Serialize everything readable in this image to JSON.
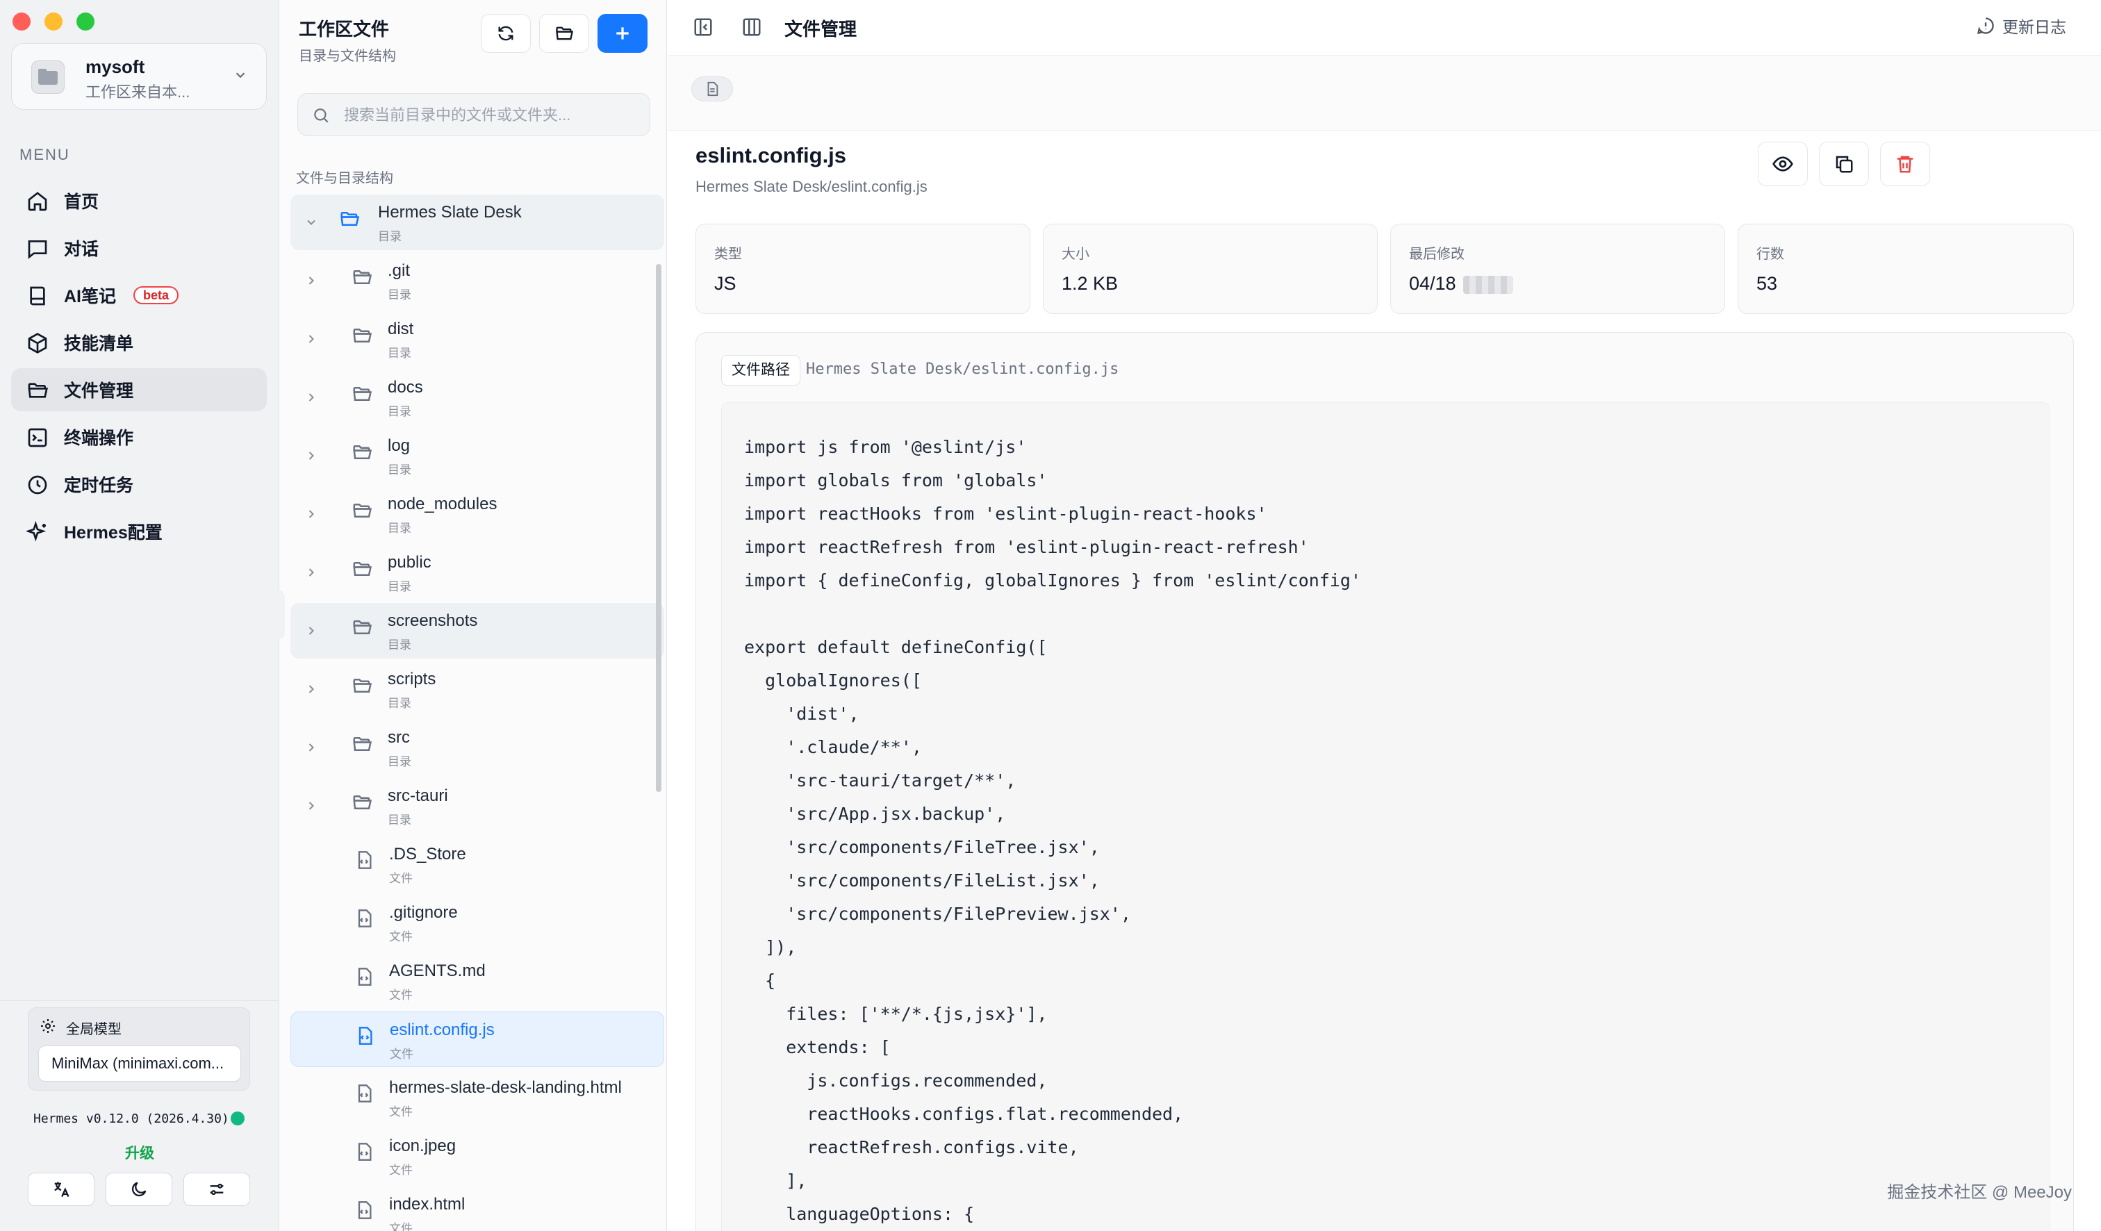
{
  "sidebar": {
    "workspace": {
      "name": "mysoft",
      "subtitle": "工作区来自本..."
    },
    "menu_label": "MENU",
    "items": [
      {
        "label": "首页",
        "icon": "home-icon"
      },
      {
        "label": "对话",
        "icon": "chat-icon"
      },
      {
        "label": "AI笔记",
        "icon": "notebook-icon",
        "badge": "beta"
      },
      {
        "label": "技能清单",
        "icon": "package-icon"
      },
      {
        "label": "文件管理",
        "icon": "folder-icon",
        "active": true
      },
      {
        "label": "终端操作",
        "icon": "terminal-icon"
      },
      {
        "label": "定时任务",
        "icon": "clock-icon"
      },
      {
        "label": "Hermes配置",
        "icon": "sparkles-icon"
      }
    ],
    "model": {
      "title": "全局模型",
      "value": "MiniMax (minimaxi.com..."
    },
    "version": "Hermes v0.12.0 (2026.4.30)",
    "upgrade": "升级"
  },
  "filepane": {
    "title": "工作区文件",
    "subtitle": "目录与文件结构",
    "search_placeholder": "搜索当前目录中的文件或文件夹...",
    "tree_label": "文件与目录结构",
    "root": {
      "name": "Hermes Slate Desk",
      "type": "目录"
    },
    "entries": [
      {
        "name": ".git",
        "type": "目录",
        "kind": "dir"
      },
      {
        "name": "dist",
        "type": "目录",
        "kind": "dir"
      },
      {
        "name": "docs",
        "type": "目录",
        "kind": "dir"
      },
      {
        "name": "log",
        "type": "目录",
        "kind": "dir"
      },
      {
        "name": "node_modules",
        "type": "目录",
        "kind": "dir"
      },
      {
        "name": "public",
        "type": "目录",
        "kind": "dir"
      },
      {
        "name": "screenshots",
        "type": "目录",
        "kind": "dir",
        "hover": true
      },
      {
        "name": "scripts",
        "type": "目录",
        "kind": "dir"
      },
      {
        "name": "src",
        "type": "目录",
        "kind": "dir"
      },
      {
        "name": "src-tauri",
        "type": "目录",
        "kind": "dir"
      },
      {
        "name": ".DS_Store",
        "type": "文件",
        "kind": "file"
      },
      {
        "name": ".gitignore",
        "type": "文件",
        "kind": "file"
      },
      {
        "name": "AGENTS.md",
        "type": "文件",
        "kind": "file"
      },
      {
        "name": "eslint.config.js",
        "type": "文件",
        "kind": "file",
        "selected": true
      },
      {
        "name": "hermes-slate-desk-landing.html",
        "type": "文件",
        "kind": "file"
      },
      {
        "name": "icon.jpeg",
        "type": "文件",
        "kind": "file"
      },
      {
        "name": "index.html",
        "type": "文件",
        "kind": "file"
      }
    ]
  },
  "main": {
    "page_title": "文件管理",
    "changelog": "更新日志",
    "file": {
      "name": "eslint.config.js",
      "path": "Hermes Slate Desk/eslint.config.js",
      "stats": [
        {
          "key": "类型",
          "value": "JS"
        },
        {
          "key": "大小",
          "value": "1.2 KB"
        },
        {
          "key": "最后修改",
          "value": "04/18"
        },
        {
          "key": "行数",
          "value": "53"
        }
      ],
      "path_label": "文件路径",
      "code_lines": [
        "import js from '@eslint/js'",
        "import globals from 'globals'",
        "import reactHooks from 'eslint-plugin-react-hooks'",
        "import reactRefresh from 'eslint-plugin-react-refresh'",
        "import { defineConfig, globalIgnores } from 'eslint/config'",
        "",
        "export default defineConfig([",
        "  globalIgnores([",
        "    'dist',",
        "    '.claude/**',",
        "    'src-tauri/target/**',",
        "    'src/App.jsx.backup',",
        "    'src/components/FileTree.jsx',",
        "    'src/components/FileList.jsx',",
        "    'src/components/FilePreview.jsx',",
        "  ]),",
        "  {",
        "    files: ['**/*.{js,jsx}'],",
        "    extends: [",
        "      js.configs.recommended,",
        "      reactHooks.configs.flat.recommended,",
        "      reactRefresh.configs.vite,",
        "    ],",
        "    languageOptions: {"
      ]
    }
  },
  "watermark": "掘金技术社区 @ MeeJoy",
  "colors": {
    "accent": "#1677ff",
    "danger": "#ef4444",
    "online": "#10b981"
  }
}
